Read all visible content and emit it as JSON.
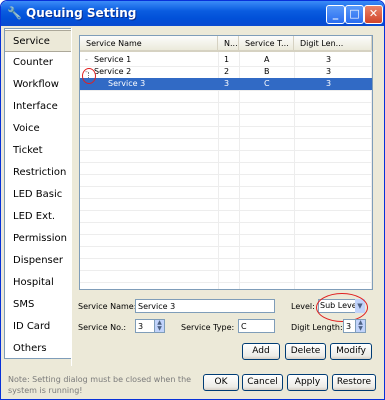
{
  "window": {
    "title": "Queuing Setting",
    "app_icon": "wrench-icon",
    "accent": "#0a5ce0"
  },
  "nav": {
    "items": [
      "Service",
      "Counter",
      "Workflow",
      "Interface",
      "Voice",
      "Ticket",
      "Restriction",
      "LED Basic",
      "LED Ext.",
      "Permission",
      "Dispenser",
      "Hospital",
      "SMS",
      "ID Card",
      "Others"
    ],
    "selected": "Service"
  },
  "table": {
    "headers": [
      "Service Name",
      "N...",
      "Service T...",
      "Digit Len..."
    ],
    "rows": [
      {
        "name": "Service 1",
        "no": "1",
        "type": "A",
        "digits": "3",
        "tree": "-"
      },
      {
        "name": "Service 2",
        "no": "2",
        "type": "B",
        "digits": "3",
        "tree": "-"
      },
      {
        "name": "Service 3",
        "no": "3",
        "type": "C",
        "digits": "3",
        "tree": ""
      }
    ],
    "selected_row": 2
  },
  "form": {
    "service_name_label": "Service Name:",
    "service_name_value": "Service 3",
    "level_label": "Level:",
    "level_value": "Sub Level",
    "service_no_label": "Service No.:",
    "service_no_value": "3",
    "service_type_label": "Service Type:",
    "service_type_value": "C",
    "digit_length_label": "Digit Length:",
    "digit_length_value": "3"
  },
  "actions": {
    "add": "Add",
    "delete": "Delete",
    "modify": "Modify"
  },
  "footer": {
    "note": "Note: Setting dialog must be closed when the system is running!",
    "ok": "OK",
    "cancel": "Cancel",
    "apply": "Apply",
    "restore": "Restore"
  },
  "highlight_color": "#e02020"
}
